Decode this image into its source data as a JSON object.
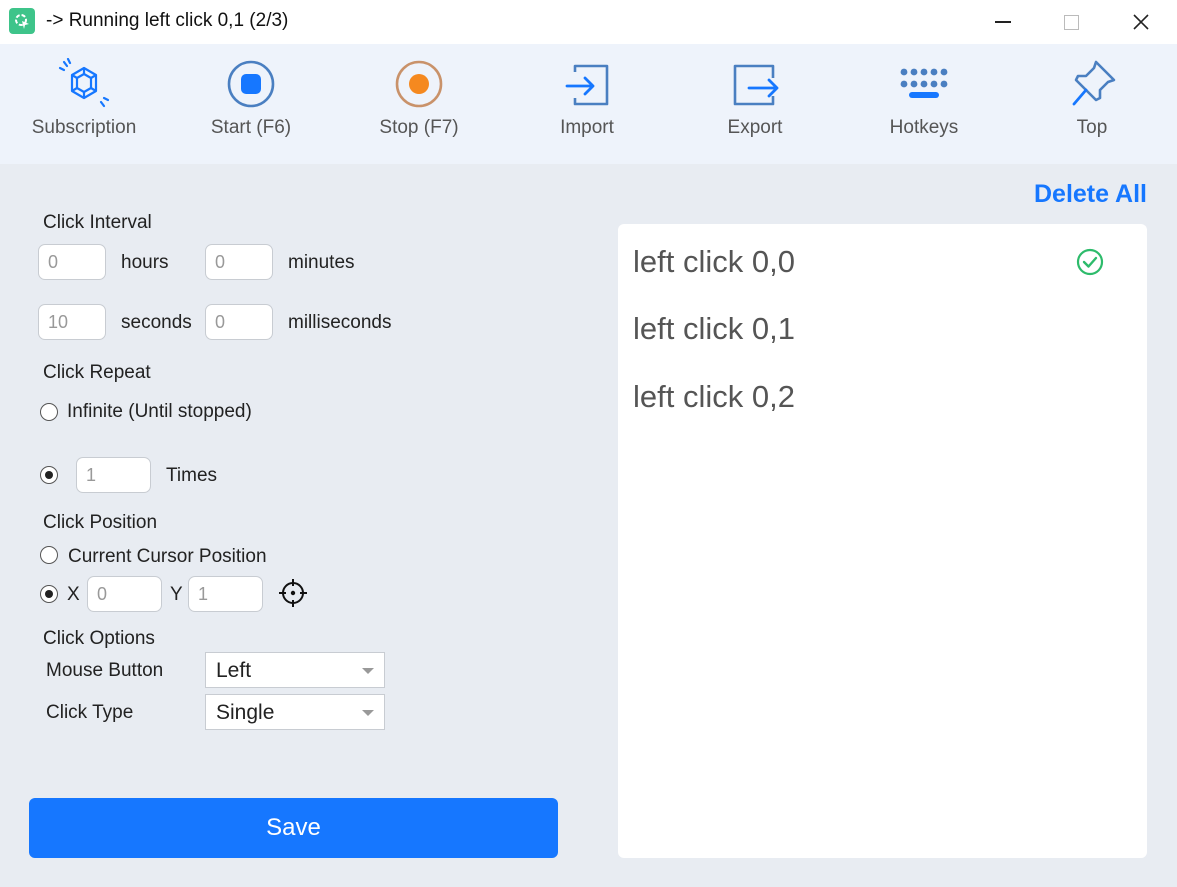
{
  "window": {
    "title": "-> Running left click 0,1 (2/3)"
  },
  "toolbar": {
    "items": [
      {
        "label": "Subscription",
        "icon": "diamond-gem-icon"
      },
      {
        "label": "Start (F6)",
        "icon": "record-stop-icon"
      },
      {
        "label": "Stop (F7)",
        "icon": "record-dot-icon"
      },
      {
        "label": "Import",
        "icon": "import-arrow-icon"
      },
      {
        "label": "Export",
        "icon": "export-arrow-icon"
      },
      {
        "label": "Hotkeys",
        "icon": "keyboard-icon"
      },
      {
        "label": "Top",
        "icon": "pin-icon"
      }
    ]
  },
  "interval": {
    "heading": "Click Interval",
    "hours_value": "0",
    "hours_label": "hours",
    "minutes_value": "0",
    "minutes_label": "minutes",
    "seconds_value": "10",
    "seconds_label": "seconds",
    "ms_value": "0",
    "ms_label": "milliseconds"
  },
  "repeat": {
    "heading": "Click Repeat",
    "infinite_label": "Infinite (Until stopped)",
    "times_value": "1",
    "times_label": "Times",
    "selected": "times"
  },
  "position": {
    "heading": "Click Position",
    "cursor_label": "Current Cursor Position",
    "x_label": "X",
    "x_value": "0",
    "y_label": "Y",
    "y_value": "1",
    "selected": "xy"
  },
  "options": {
    "heading": "Click Options",
    "mouse_button_label": "Mouse Button",
    "mouse_button_value": "Left",
    "click_type_label": "Click Type",
    "click_type_value": "Single"
  },
  "save_label": "Save",
  "list": {
    "delete_all_label": "Delete All",
    "items": [
      {
        "label": "left click 0,0",
        "done": true
      },
      {
        "label": "left click 0,1",
        "done": false
      },
      {
        "label": "left click 0,2",
        "done": false
      }
    ]
  },
  "colors": {
    "accent": "#1677ff",
    "toolbar_icon": "#4a7fc1",
    "stop_orange": "#f5891f",
    "success": "#2dbb6b"
  }
}
